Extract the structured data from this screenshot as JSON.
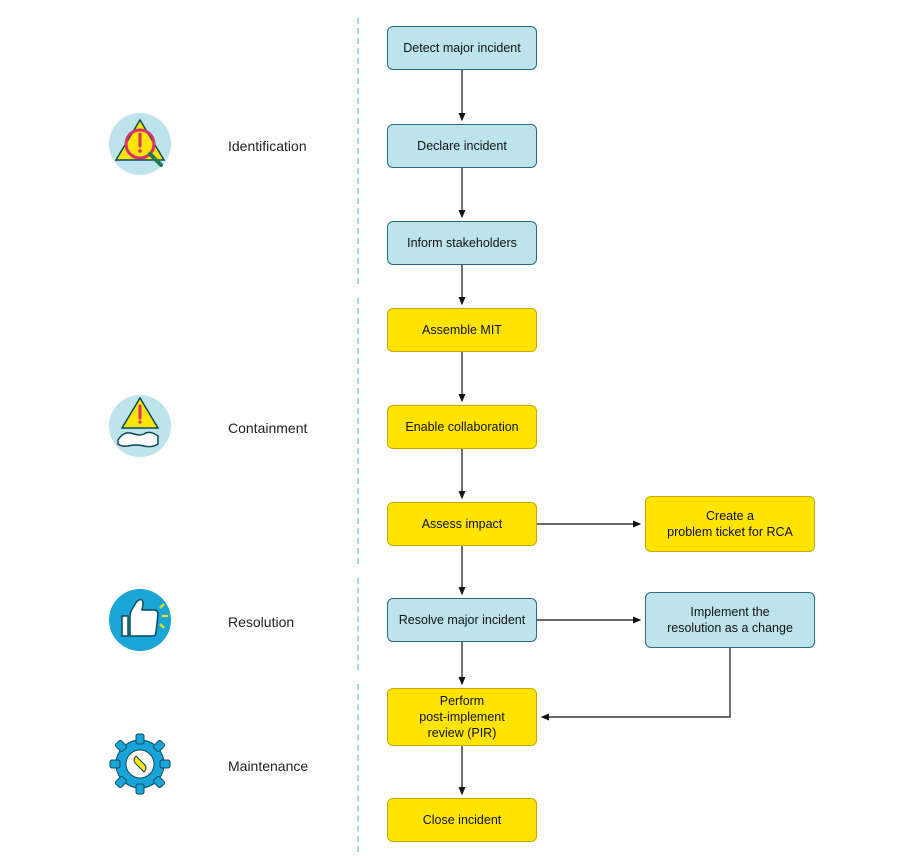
{
  "phases": [
    {
      "id": "identification",
      "label": "Identification"
    },
    {
      "id": "containment",
      "label": "Containment"
    },
    {
      "id": "resolution",
      "label": "Resolution"
    },
    {
      "id": "maintenance",
      "label": "Maintenance"
    }
  ],
  "steps": {
    "detect": {
      "label": "Detect major incident",
      "color": "blue"
    },
    "declare": {
      "label": "Declare incident",
      "color": "blue"
    },
    "inform": {
      "label": "Inform stakeholders",
      "color": "blue"
    },
    "assemble": {
      "label": "Assemble MIT",
      "color": "yellow"
    },
    "enable": {
      "label": "Enable collaboration",
      "color": "yellow"
    },
    "assess": {
      "label": "Assess impact",
      "color": "yellow"
    },
    "createTicket": {
      "label": "Create a\nproblem ticket for RCA",
      "color": "yellow"
    },
    "resolve": {
      "label": "Resolve major incident",
      "color": "blue"
    },
    "implement": {
      "label": "Implement the\nresolution as a change",
      "color": "blue"
    },
    "pir": {
      "label": "Perform\npost-implement\nreview (PIR)",
      "color": "yellow"
    },
    "close": {
      "label": "Close incident",
      "color": "yellow"
    }
  }
}
